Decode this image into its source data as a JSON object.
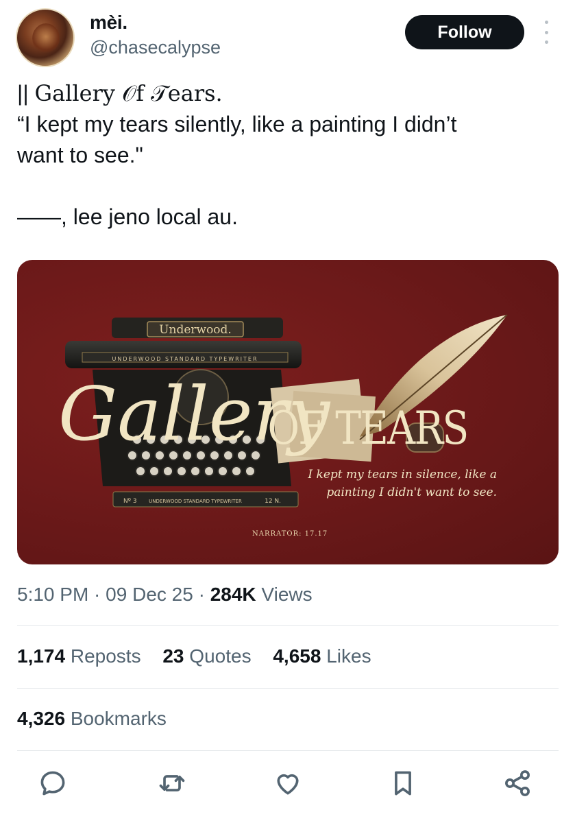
{
  "user": {
    "display_name": "mèi.",
    "handle": "@chasecalypse"
  },
  "follow_label": "Follow",
  "tweet": {
    "line1_prefix": "|| ",
    "line1_title": "Gallery 𝒪f 𝒯ears.",
    "line2": "“I kept my tears silently, like a painting I didn’t",
    "line3": "want to see.\"",
    "line4": "——, lee jeno local au."
  },
  "media": {
    "brand": "Underwood.",
    "typewriter_bar": "UNDERWOOD STANDARD TYPEWRITER",
    "typewriter_plate_left": "Nº 3",
    "typewriter_plate_mid": "UNDERWOOD STANDARD TYPEWRITER",
    "typewriter_plate_right": "12 N.",
    "title_script": "Gallery",
    "title_caps": "OF TEARS",
    "quote_line1": "I kept my tears in silence, like a",
    "quote_line2": "painting I didn't want to see.",
    "narrator": "NARRATOR: 17.17"
  },
  "meta": {
    "time": "5:10 PM",
    "date": "09 Dec 25",
    "views_count": "284K",
    "views_label": "Views"
  },
  "stats": {
    "reposts_count": "1,174",
    "reposts_label": "Reposts",
    "quotes_count": "23",
    "quotes_label": "Quotes",
    "likes_count": "4,658",
    "likes_label": "Likes",
    "bookmarks_count": "4,326",
    "bookmarks_label": "Bookmarks"
  },
  "actions": [
    "reply-icon",
    "repost-icon",
    "like-icon",
    "bookmark-icon",
    "share-icon"
  ],
  "colors": {
    "text": "#0f1419",
    "secondary": "#536471",
    "accent": "#1d9bf0",
    "media_bg": "#6e1a1a",
    "media_text": "#e9d7ae"
  }
}
